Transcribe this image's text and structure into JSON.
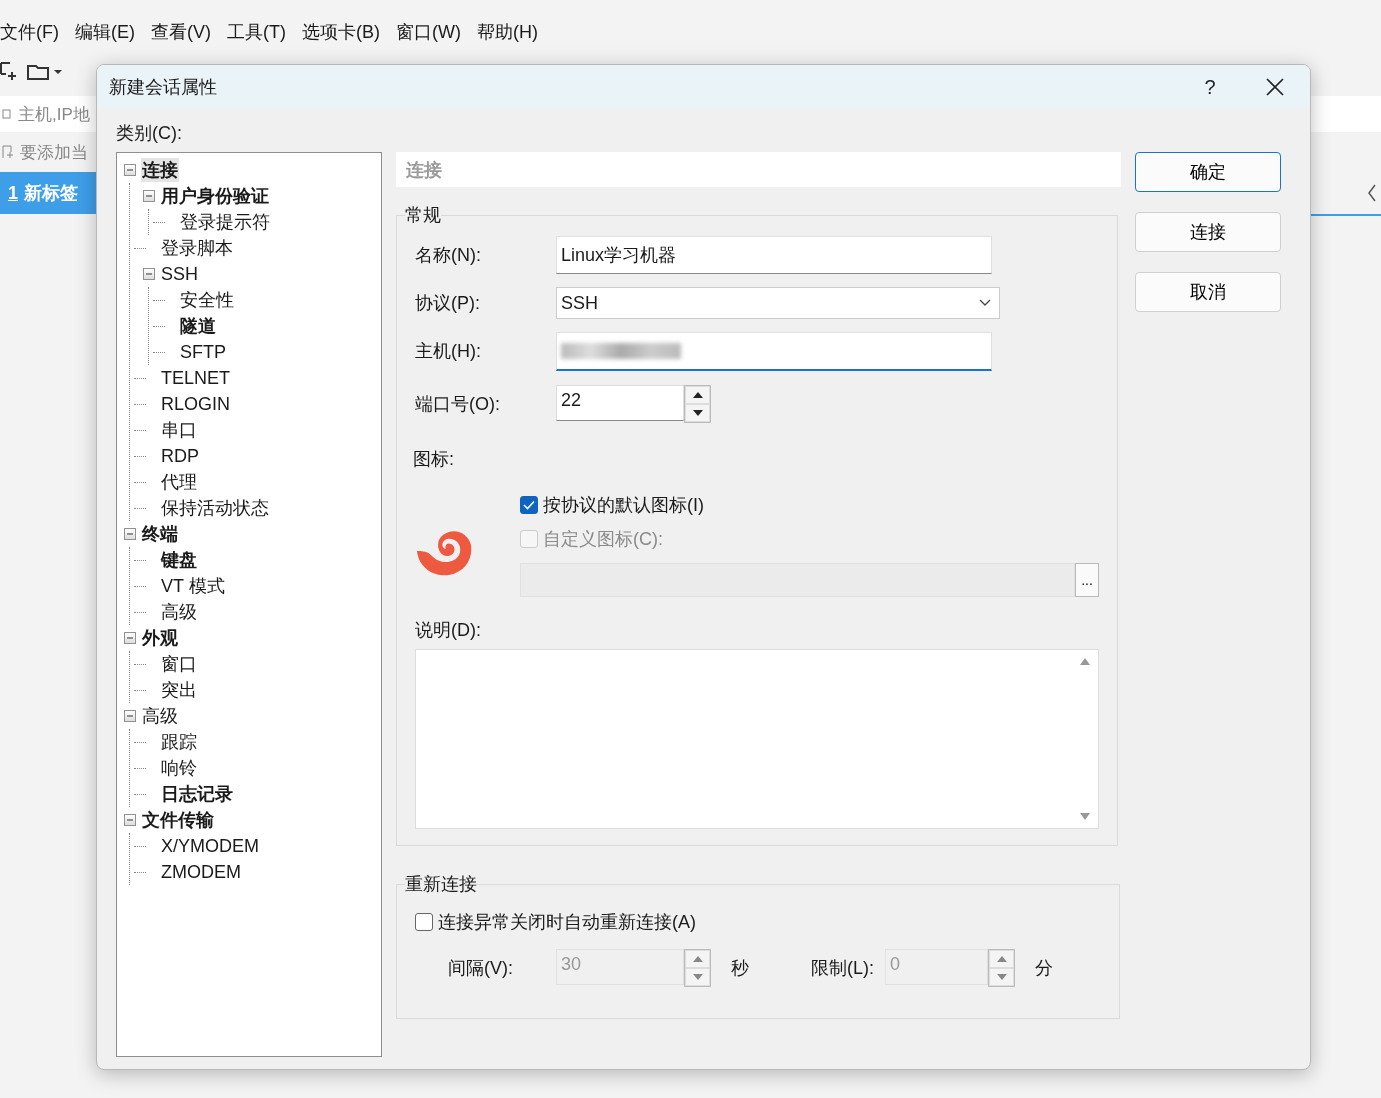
{
  "app": {
    "menu": [
      "文件(F)",
      "编辑(E)",
      "查看(V)",
      "工具(T)",
      "选项卡(B)",
      "窗口(W)",
      "帮助(H)"
    ],
    "address_placeholder": "主机,IP地",
    "bookmark_hint": "要添加当",
    "tab": {
      "number": "1",
      "label": "新标签",
      "selected": true
    }
  },
  "dialog": {
    "title": "新建会话属性",
    "help": "?",
    "category_label": "类别(C):",
    "tree": [
      {
        "label": "连接",
        "bold": true,
        "selected": true,
        "expanded": true,
        "children": [
          {
            "label": "用户身份验证",
            "bold": true,
            "selected": false,
            "expanded": true,
            "children": [
              {
                "label": "登录提示符",
                "bold": false,
                "selected": false
              }
            ]
          },
          {
            "label": "登录脚本",
            "bold": false,
            "selected": false
          },
          {
            "label": "SSH",
            "bold": false,
            "selected": false,
            "expanded": true,
            "children": [
              {
                "label": "安全性",
                "bold": false,
                "selected": false
              },
              {
                "label": "隧道",
                "bold": true,
                "selected": false
              },
              {
                "label": "SFTP",
                "bold": false,
                "selected": false
              }
            ]
          },
          {
            "label": "TELNET",
            "bold": false,
            "selected": false
          },
          {
            "label": "RLOGIN",
            "bold": false,
            "selected": false
          },
          {
            "label": "串口",
            "bold": false,
            "selected": false
          },
          {
            "label": "RDP",
            "bold": false,
            "selected": false
          },
          {
            "label": "代理",
            "bold": false,
            "selected": false
          },
          {
            "label": "保持活动状态",
            "bold": false,
            "selected": false
          }
        ]
      },
      {
        "label": "终端",
        "bold": true,
        "selected": false,
        "expanded": true,
        "children": [
          {
            "label": "键盘",
            "bold": true,
            "selected": false
          },
          {
            "label": "VT 模式",
            "bold": false,
            "selected": false
          },
          {
            "label": "高级",
            "bold": false,
            "selected": false
          }
        ]
      },
      {
        "label": "外观",
        "bold": true,
        "selected": false,
        "expanded": true,
        "children": [
          {
            "label": "窗口",
            "bold": false,
            "selected": false
          },
          {
            "label": "突出",
            "bold": false,
            "selected": false
          }
        ]
      },
      {
        "label": "高级",
        "bold": false,
        "selected": false,
        "expanded": true,
        "children": [
          {
            "label": "跟踪",
            "bold": false,
            "selected": false
          },
          {
            "label": "响铃",
            "bold": false,
            "selected": false
          },
          {
            "label": "日志记录",
            "bold": true,
            "selected": false
          }
        ]
      },
      {
        "label": "文件传输",
        "bold": true,
        "selected": false,
        "expanded": true,
        "children": [
          {
            "label": "X/YMODEM",
            "bold": false,
            "selected": false
          },
          {
            "label": "ZMODEM",
            "bold": false,
            "selected": false
          }
        ]
      }
    ],
    "section_title": "连接",
    "general": {
      "legend": "常规",
      "name_label": "名称(N):",
      "name_value": "Linux学习机器",
      "protocol_label": "协议(P):",
      "protocol_value": "SSH",
      "host_label": "主机(H):",
      "port_label": "端口号(O):",
      "port_value": "22",
      "icon_label": "图标:",
      "default_icon": {
        "label": "按协议的默认图标(I)",
        "checked": true,
        "disabled": false
      },
      "custom_icon": {
        "label": "自定义图标(C):",
        "checked": false,
        "disabled": true
      },
      "browse": "...",
      "description_label": "说明(D):"
    },
    "reconnect": {
      "legend": "重新连接",
      "auto": {
        "label": "连接异常关闭时自动重新连接(A)",
        "checked": false
      },
      "disabled": true,
      "interval_label": "间隔(V):",
      "interval_value": "30",
      "interval_unit": "秒",
      "limit_label": "限制(L):",
      "limit_value": "0",
      "limit_unit": "分"
    },
    "buttons": [
      {
        "label": "确定",
        "default": true
      },
      {
        "label": "连接",
        "default": false
      },
      {
        "label": "取消",
        "default": false
      }
    ]
  }
}
